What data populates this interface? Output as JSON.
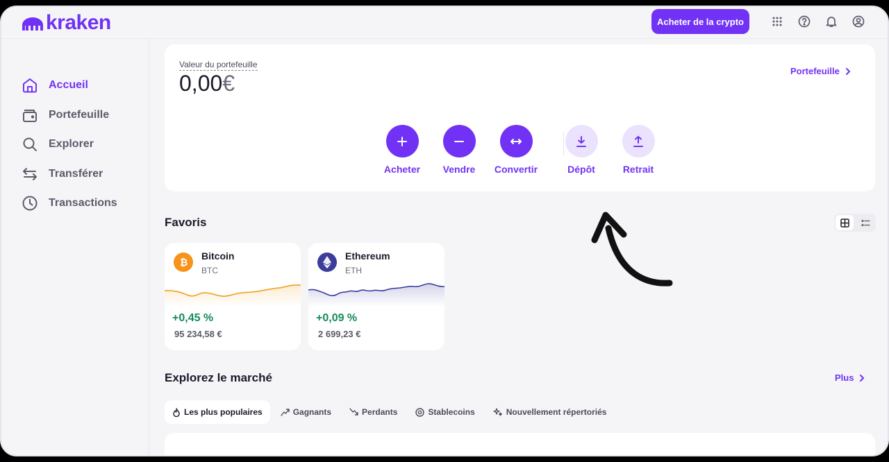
{
  "header": {
    "logo_text": "kraken",
    "buy_crypto_label": "Acheter de la crypto",
    "icons": [
      "grid-icon",
      "help-icon",
      "bell-icon",
      "user-icon"
    ]
  },
  "sidebar": {
    "items": [
      {
        "label": "Accueil",
        "icon": "home-icon",
        "active": true
      },
      {
        "label": "Portefeuille",
        "icon": "wallet-icon",
        "active": false
      },
      {
        "label": "Explorer",
        "icon": "search-icon",
        "active": false
      },
      {
        "label": "Transférer",
        "icon": "transfer-icon",
        "active": false
      },
      {
        "label": "Transactions",
        "icon": "clock-icon",
        "active": false
      }
    ]
  },
  "portfolio": {
    "label": "Valeur du portefeuille",
    "value": "0,00",
    "currency": "€",
    "link_label": "Portefeuille",
    "actions": [
      {
        "label": "Acheter",
        "icon": "plus-icon"
      },
      {
        "label": "Vendre",
        "icon": "minus-icon"
      },
      {
        "label": "Convertir",
        "icon": "convert-icon"
      },
      {
        "label": "Dépôt",
        "icon": "deposit-icon"
      },
      {
        "label": "Retrait",
        "icon": "withdraw-icon"
      }
    ]
  },
  "favorites": {
    "title": "Favoris",
    "cards": [
      {
        "name": "Bitcoin",
        "symbol": "BTC",
        "change": "+0,45 %",
        "price": "95 234,58 €",
        "color": "#f7931a",
        "line_color": "#f0a830"
      },
      {
        "name": "Ethereum",
        "symbol": "ETH",
        "change": "+0,09 %",
        "price": "2 699,23 €",
        "color": "#3c3c9b",
        "line_color": "#3d3d9f"
      }
    ]
  },
  "market": {
    "title": "Explorez le marché",
    "more_label": "Plus",
    "tabs": [
      {
        "label": "Les plus populaires",
        "icon": "fire-icon",
        "active": true
      },
      {
        "label": "Gagnants",
        "icon": "trend-up-icon",
        "active": false
      },
      {
        "label": "Perdants",
        "icon": "trend-down-icon",
        "active": false
      },
      {
        "label": "Stablecoins",
        "icon": "stable-icon",
        "active": false
      },
      {
        "label": "Nouvellement répertoriés",
        "icon": "sparkle-icon",
        "active": false
      }
    ]
  },
  "colors": {
    "accent": "#7132f5",
    "accent_light": "#ebe3fe",
    "positive": "#148a5a"
  }
}
